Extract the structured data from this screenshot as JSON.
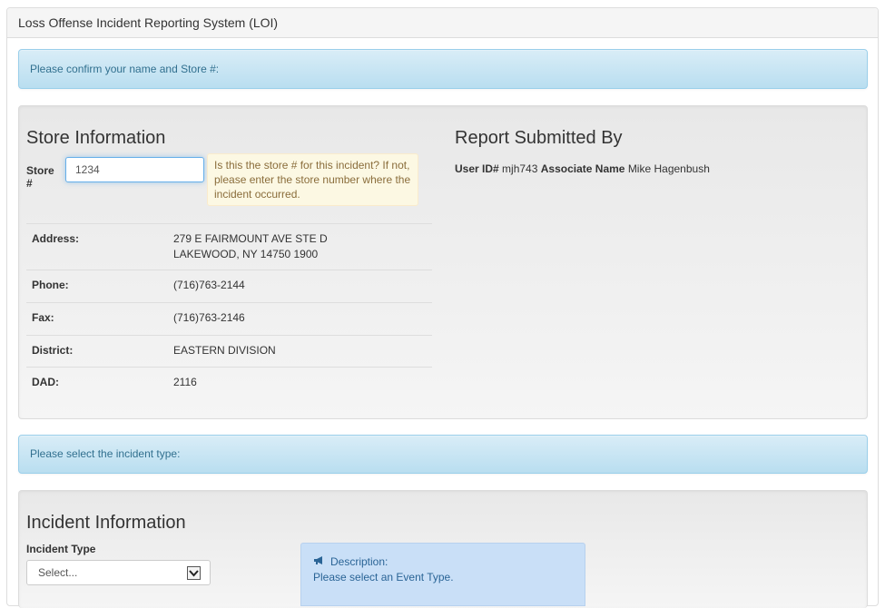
{
  "app": {
    "title": "Loss Offense Incident Reporting System (LOI)"
  },
  "alerts": {
    "confirm": "Please confirm your name and Store #:",
    "select_type": "Please select the incident type:"
  },
  "store": {
    "heading": "Store Information",
    "store_label": "Store #",
    "store_value": "1234",
    "tooltip": "Is this the store # for this incident? If not, please enter the store number where the incident occurred.",
    "rows": [
      {
        "label": "Address:",
        "value": "279 E FAIRMOUNT AVE STE D",
        "value2": "LAKEWOOD, NY 14750 1900"
      },
      {
        "label": "Phone:",
        "value": "(716)763-2144"
      },
      {
        "label": "Fax:",
        "value": "(716)763-2146"
      },
      {
        "label": "District:",
        "value": "EASTERN DIVISION"
      },
      {
        "label": "DAD:",
        "value": "2116"
      }
    ]
  },
  "submitter": {
    "heading": "Report Submitted By",
    "user_id_label": "User ID#",
    "user_id": "mjh743",
    "associate_label": "Associate Name",
    "associate_name": "Mike Hagenbush"
  },
  "incident": {
    "heading": "Incident Information",
    "type_label": "Incident Type",
    "type_selected": "Select...",
    "description_title": "Description:",
    "description_text": "Please select an Event Type."
  },
  "icons": {
    "select_arrow": "chevron-down-icon",
    "description": "megaphone-icon"
  },
  "colors": {
    "info_text": "#31708f",
    "info_bg": "#d9edf7",
    "warning_bg": "#fcf8e3",
    "warning_text": "#8a6d3b"
  }
}
